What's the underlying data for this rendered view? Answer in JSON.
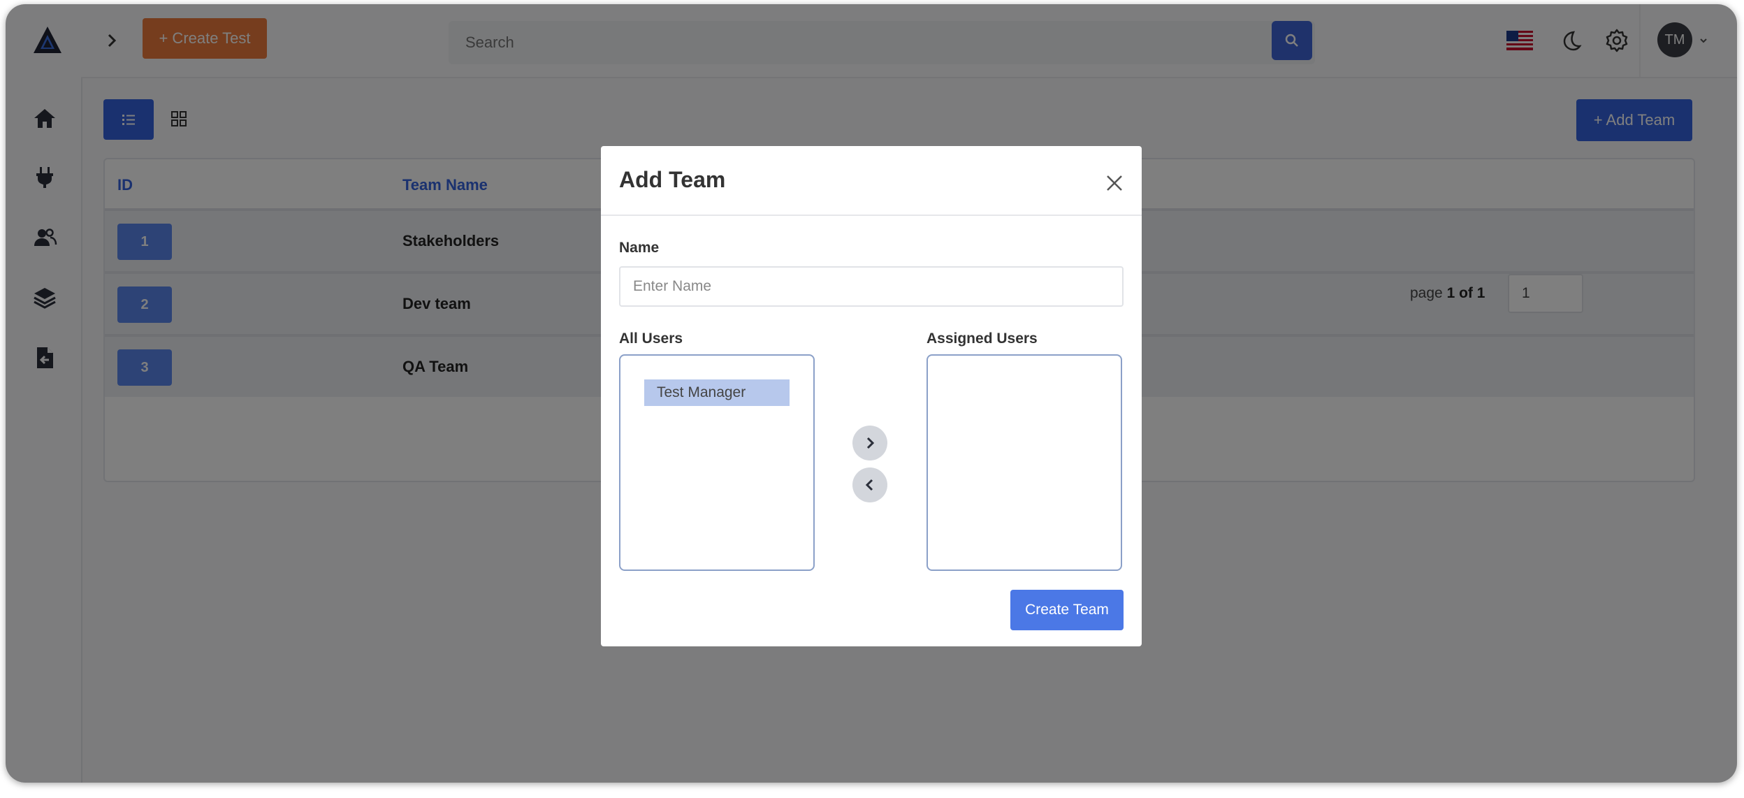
{
  "topbar": {
    "create_test_label": "+ Create Test",
    "search_placeholder": "Search",
    "avatar_initials": "TM"
  },
  "toolbar": {
    "add_team_label": "+ Add Team"
  },
  "table": {
    "columns": [
      "ID",
      "Team Name"
    ],
    "rows": [
      {
        "id": "1",
        "name": "Stakeholders"
      },
      {
        "id": "2",
        "name": "Dev team"
      },
      {
        "id": "3",
        "name": "QA Team"
      }
    ]
  },
  "pagination": {
    "prefix": "page ",
    "current_of_total": "1 of 1",
    "page_input_value": "1"
  },
  "modal": {
    "title": "Add Team",
    "name_label": "Name",
    "name_placeholder": "Enter Name",
    "all_users_label": "All Users",
    "assigned_users_label": "Assigned Users",
    "all_users": [
      "Test Manager"
    ],
    "assigned_users": [],
    "submit_label": "Create Team"
  },
  "colors": {
    "primary": "#3462df",
    "create_test": "#ec7b3c",
    "badge": "#5a86ec"
  }
}
